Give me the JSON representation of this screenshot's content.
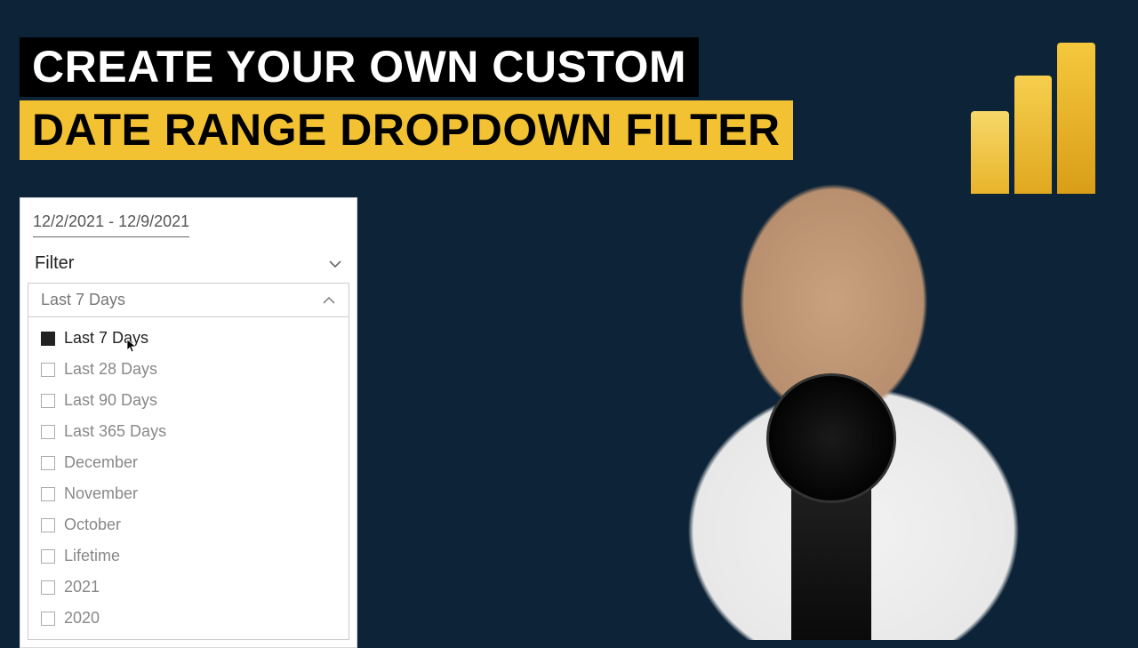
{
  "title": {
    "line1": "CREATE YOUR OWN CUSTOM",
    "line2": "DATE RANGE DROPDOWN FILTER"
  },
  "panel": {
    "date_range": "12/2/2021 - 12/9/2021",
    "filter_label": "Filter",
    "dropdown_selected": "Last 7 Days",
    "options": [
      {
        "label": "Last 7 Days",
        "checked": true
      },
      {
        "label": "Last 28 Days",
        "checked": false
      },
      {
        "label": "Last 90 Days",
        "checked": false
      },
      {
        "label": "Last 365 Days",
        "checked": false
      },
      {
        "label": "December",
        "checked": false
      },
      {
        "label": "November",
        "checked": false
      },
      {
        "label": "October",
        "checked": false
      },
      {
        "label": "Lifetime",
        "checked": false
      },
      {
        "label": "2021",
        "checked": false
      },
      {
        "label": "2020",
        "checked": false
      }
    ]
  },
  "logo": {
    "name": "power-bi"
  }
}
